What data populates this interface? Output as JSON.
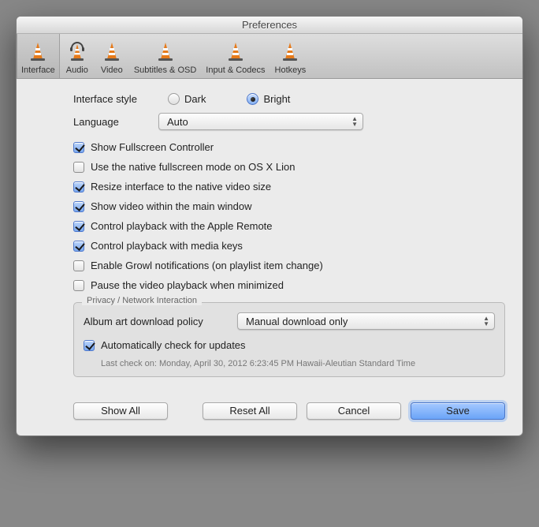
{
  "title": "Preferences",
  "toolbar": {
    "tabs": [
      {
        "label": "Interface",
        "selected": true
      },
      {
        "label": "Audio"
      },
      {
        "label": "Video"
      },
      {
        "label": "Subtitles & OSD"
      },
      {
        "label": "Input & Codecs"
      },
      {
        "label": "Hotkeys"
      }
    ]
  },
  "interface": {
    "style_label": "Interface style",
    "radios": {
      "dark": "Dark",
      "bright": "Bright",
      "selected": "bright"
    },
    "language_label": "Language",
    "language_value": "Auto",
    "checks": [
      {
        "label": "Show Fullscreen Controller",
        "checked": true
      },
      {
        "label": "Use the native fullscreen mode on OS X Lion",
        "checked": false
      },
      {
        "label": "Resize interface to the native video size",
        "checked": true
      },
      {
        "label": "Show video within the main window",
        "checked": true
      },
      {
        "label": "Control playback with the Apple Remote",
        "checked": true
      },
      {
        "label": "Control playback with media keys",
        "checked": true
      },
      {
        "label": "Enable Growl notifications (on playlist item change)",
        "checked": false
      },
      {
        "label": "Pause the video playback when minimized",
        "checked": false
      }
    ]
  },
  "privacy": {
    "group_title": "Privacy / Network Interaction",
    "album_label": "Album art download policy",
    "album_value": "Manual download only",
    "updates_label": "Automatically check for updates",
    "updates_checked": true,
    "last_check": "Last check on: Monday, April 30, 2012 6:23:45 PM Hawaii-Aleutian Standard Time"
  },
  "buttons": {
    "show_all": "Show All",
    "reset_all": "Reset All",
    "cancel": "Cancel",
    "save": "Save"
  }
}
